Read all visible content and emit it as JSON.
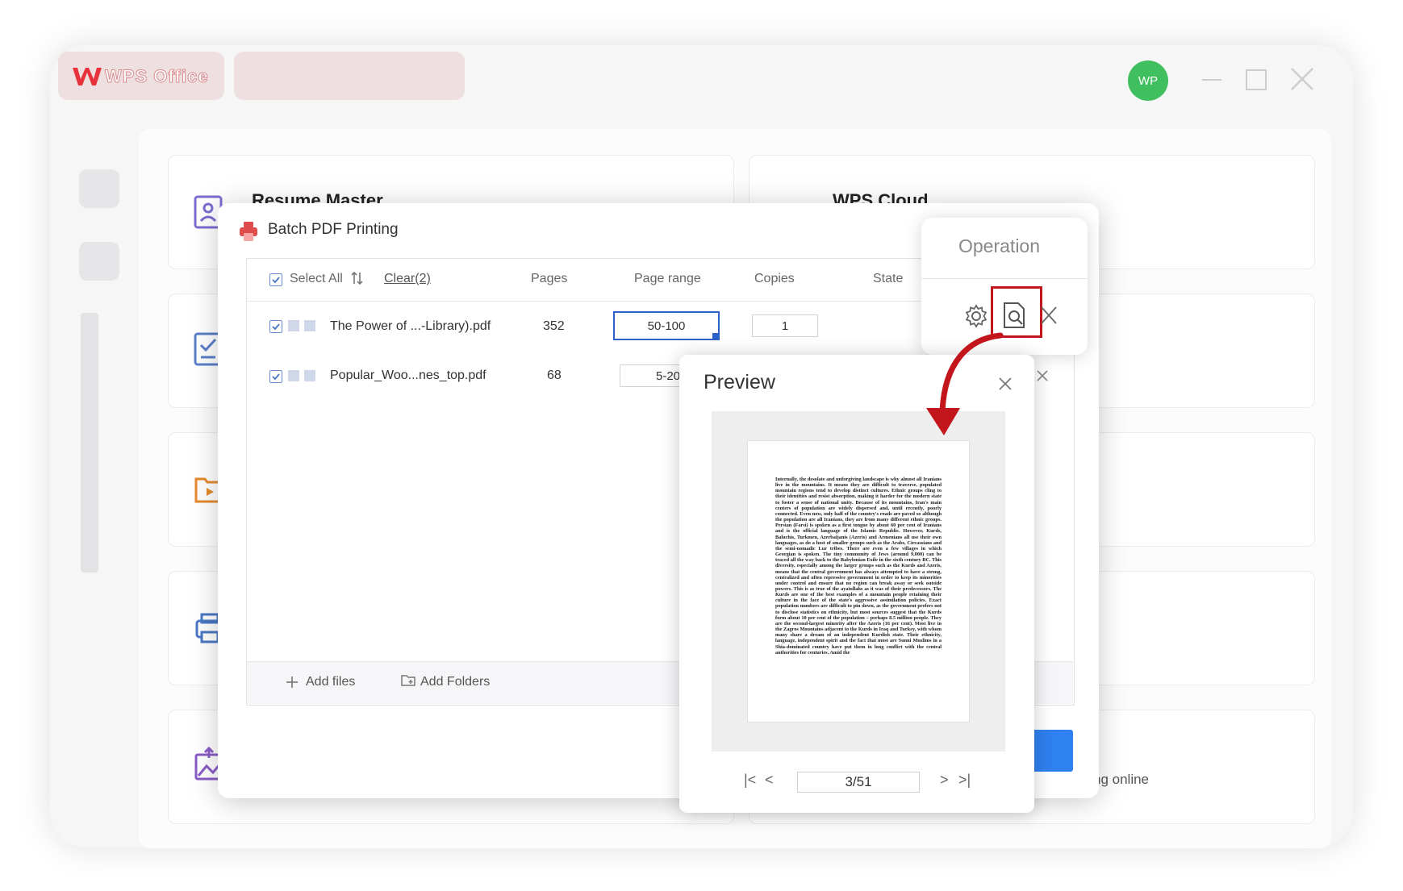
{
  "app": {
    "brand": "WPS Office",
    "avatar_initials": "WP"
  },
  "cards": {
    "resume_master": "Resume Master",
    "wps_cloud": "WPS Cloud",
    "online_tail": "ng online"
  },
  "batch_dialog": {
    "title": "Batch PDF Printing",
    "select_all": "Select All",
    "clear": "Clear(2)",
    "columns": {
      "pages": "Pages",
      "page_range": "Page range",
      "copies": "Copies",
      "state": "State"
    },
    "files": [
      {
        "name": "The Power of ...-Library).pdf",
        "pages": "352",
        "page_range": "50-100",
        "copies": "1",
        "checked": true
      },
      {
        "name": "Popular_Woo...nes_top.pdf",
        "pages": "68",
        "page_range": "5-20",
        "copies": "",
        "checked": true
      }
    ],
    "add_files": "Add files",
    "add_folders": "Add Folders"
  },
  "operation": {
    "title": "Operation",
    "icons": [
      "gear-icon",
      "preview-search-icon",
      "close-icon"
    ]
  },
  "preview": {
    "title": "Preview",
    "page_indicator": "3/51",
    "page_text": "Internally, the desolate and unforgiving landscape is why almost all Iranians live in the mountains. It means they are difficult to traverse, populated mountain regions tend to develop distinct cultures. Ethnic groups cling to their identities and resist absorption, making it harder for the modern state to foster a sense of national unity. Because of its mountains, Iran's main centers of population are widely dispersed and, until recently, poorly connected. Even now, only half of the country's roads are paved so although the population are all Iranians, they are from many different ethnic groups. Persian (Farsi) is spoken as a first tongue by about 60 per cent of Iranians and is the official language of the Islamic Republic. However, Kurds, Baluchis, Turkmen, Azerbaijanis (Azeris) and Armenians all use their own languages, as do a host of smaller groups such as the Arabs, Circassians and the semi-nomadic Lur tribes. There are even a few villages in which Georgian is spoken. The tiny community of Jews (around 9,000) can be traced all the way back to the Babylonian Exile in the sixth century BC. This diversity, especially among the larger groups such as the Kurds and Azeris, means that the central government has always attempted to have a strong, centralized and often repressive government in order to keep its minorities under control and ensure that no region can break away or seek outside powers. This is as true of the ayatollahs as it was of their predecessors. The Kurds are one of the best examples of a mountain people retaining their culture in the face of the state's aggressive assimilation policies. Exact population numbers are difficult to pin down, as the government prefers not to disclose statistics on ethnicity, but most sources suggest that the Kurds form about 10 per cent of the population – perhaps 8.5 million people. They are the second-largest minority after the Azeris (16 per cent). Most live in the Zagros Mountains adjacent to the Kurds in Iraq and Turkey, with whom many share a dream of an independent Kurdish state. Their ethnicity, language, independent spirit and the fact that most are Sunni Muslims in a Shia-dominated country have put them in long conflict with the central authorities for centuries. Amid the"
  },
  "colors": {
    "accent_blue": "#2f80f0",
    "highlight_red": "#c2161c",
    "avatar_green": "#3fbf5e"
  }
}
